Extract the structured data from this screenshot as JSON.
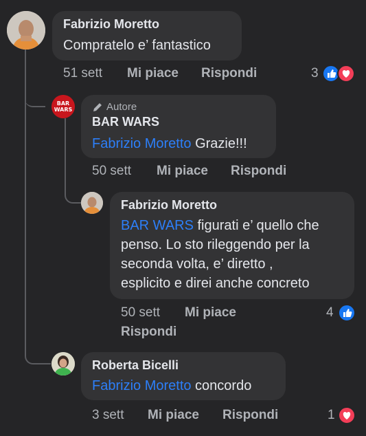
{
  "comments": [
    {
      "author": "Fabrizio Moretto",
      "text": "Compratelo e’ fantastico",
      "time": "51 sett",
      "like_label": "Mi piace",
      "reply_label": "Rispondi",
      "reaction_count": "3",
      "reactions": [
        "like-icon",
        "heart-icon"
      ]
    },
    {
      "badge": "Autore",
      "badge_icon": "pencil-icon",
      "author": "BAR WARS",
      "avatar_logo": "BAR WARS",
      "mention": "Fabrizio Moretto",
      "text": "Grazie!!!",
      "time": "50 sett",
      "like_label": "Mi piace",
      "reply_label": "Rispondi"
    },
    {
      "author": "Fabrizio Moretto",
      "mention": "BAR WARS",
      "text_lines": [
        " figurati e’ quello che",
        "penso. Lo sto rileggendo per la",
        "seconda volta, e’ diretto ,",
        "esplicito e direi anche concreto"
      ],
      "time": "50 sett",
      "like_label": "Mi piace",
      "reply_label": "Rispondi",
      "reaction_count": "4",
      "reactions": [
        "like-icon"
      ]
    },
    {
      "author": "Roberta Bicelli",
      "mention": "Fabrizio Moretto",
      "text": " concordo",
      "time": "3 sett",
      "like_label": "Mi piace",
      "reply_label": "Rispondi",
      "reaction_count": "1",
      "reactions": [
        "heart-icon"
      ]
    }
  ],
  "colors": {
    "background": "#252527",
    "bubble": "#333335",
    "mention": "#2d7ff9",
    "like": "#1877f2",
    "heart": "#f33e58"
  }
}
